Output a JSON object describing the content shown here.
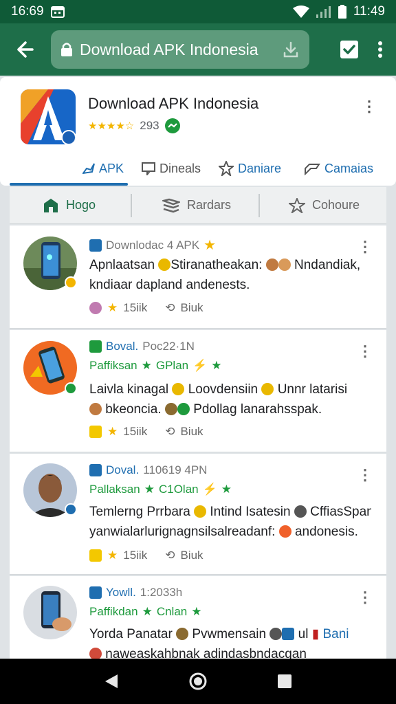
{
  "status": {
    "time": "16:69",
    "clock": "11:49"
  },
  "toolbar": {
    "url_text": "Download APK Indonesia"
  },
  "app": {
    "title": "Download APK Indonesia",
    "rating_count": "293",
    "tabs": [
      "APK",
      "Dineals",
      "Daniare",
      "Camaias"
    ]
  },
  "filters": [
    "Hogo",
    "Rardars",
    "Cohoure"
  ],
  "posts": [
    {
      "source": "Downlodac 4 APK",
      "time": "",
      "sub": "",
      "line1": "Apnlaatsan",
      "line1b": "Stiranatheakan:",
      "line1c": "Nndandiak,",
      "line2": "kndiaar dapland andenests.",
      "count": "15iik",
      "action": "Biuk"
    },
    {
      "source": "Boval.",
      "time": "Poc22·1N",
      "sub": "Paffiksan",
      "sub2": "GPlan",
      "line1": "Laivla kinagal",
      "line1b": "Loovdensiin",
      "line1c": "Unnr latarisi",
      "line2a": "bkeoncia.",
      "line2b": "Pdollag lanarahsspak.",
      "count": "15iik",
      "action": "Biuk"
    },
    {
      "source": "Doval.",
      "time": "110619 4PN",
      "sub": "Pallaksan",
      "sub2": "C1Olan",
      "line1": "Temlerng Prrbara",
      "line1b": "Intind Isatesin",
      "line1c": "CffiasSpan",
      "line2a": "yanwialarlurignagnsilsalreadanf:",
      "line2b": "andonesis.",
      "count": "15iik",
      "action": "Biuk"
    },
    {
      "source": "Yowll.",
      "time": "1:2033h",
      "sub": "Paffikdan",
      "sub2": "Cnlan",
      "line1": "Yorda Panatar",
      "line1b": "Pvwmensain",
      "line1c": "ul",
      "line1d": "Bani",
      "line2": "naweaskahbnak adindasbndacgan"
    }
  ],
  "colors": {
    "statusbar": "#0f5a37",
    "toolbar": "#1e6e49",
    "urlbar": "#5e9b7c",
    "accent_blue": "#1f6eb0",
    "accent_green": "#1e9a3d"
  }
}
